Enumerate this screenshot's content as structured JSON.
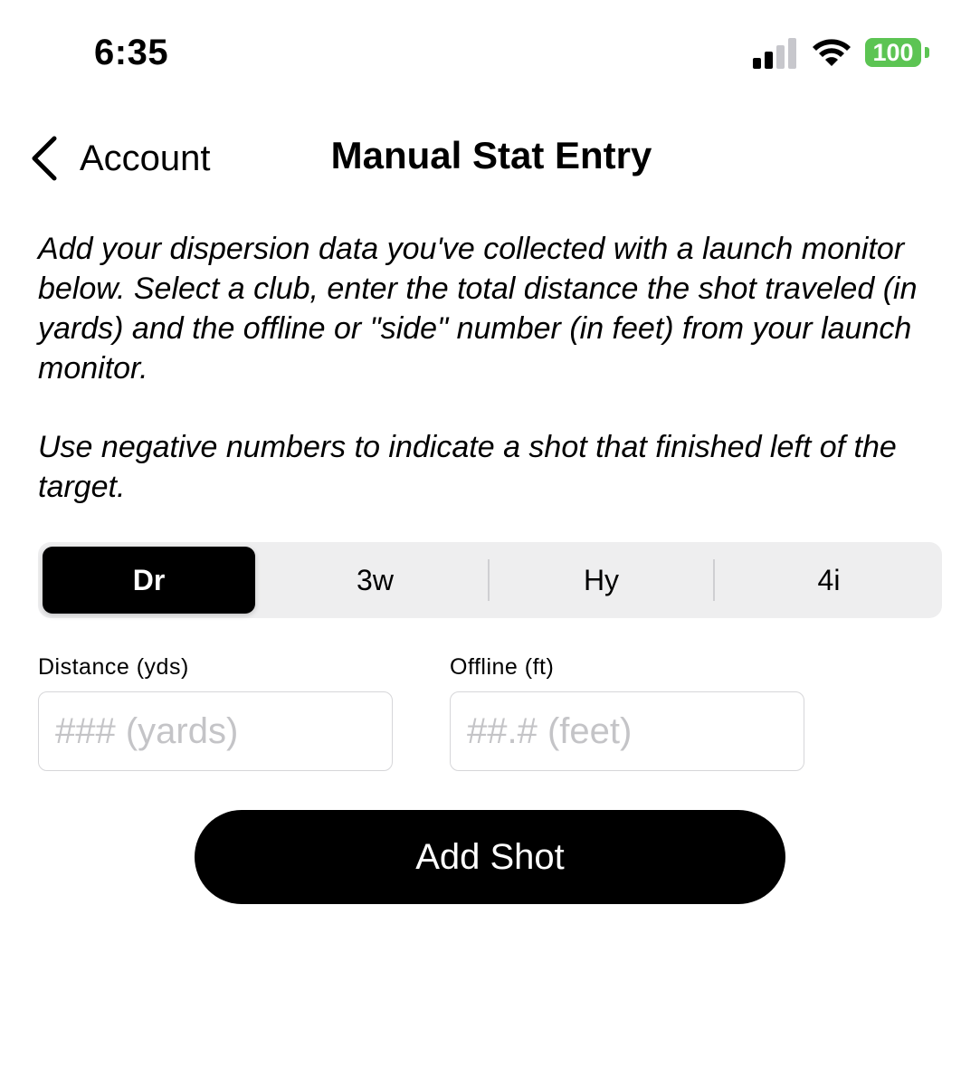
{
  "status_bar": {
    "time": "6:35",
    "battery_level": "100",
    "battery_color": "#5cc453",
    "icons": [
      "signal-icon",
      "wifi-icon",
      "battery-icon"
    ]
  },
  "nav": {
    "back_label": "Account",
    "back_icon": "chevron-left-icon",
    "title": "Manual Stat Entry"
  },
  "description": {
    "paragraph_1": "Add your dispersion data you've collected with a launch monitor below. Select a club, enter the total distance the shot traveled (in yards) and the offline or \"side\" number (in feet) from your launch monitor.",
    "paragraph_2": "Use negative numbers to indicate a shot that finished left of the target."
  },
  "club_selector": {
    "options": [
      {
        "label": "Dr",
        "selected": true
      },
      {
        "label": "3w",
        "selected": false
      },
      {
        "label": "Hy",
        "selected": false
      },
      {
        "label": "4i",
        "selected": false
      }
    ]
  },
  "distance_field": {
    "label": "Distance (yds)",
    "placeholder": "### (yards)",
    "value": ""
  },
  "offline_field": {
    "label": "Offline (ft)",
    "placeholder": "##.# (feet)",
    "value": ""
  },
  "add_button": {
    "label": "Add Shot"
  }
}
